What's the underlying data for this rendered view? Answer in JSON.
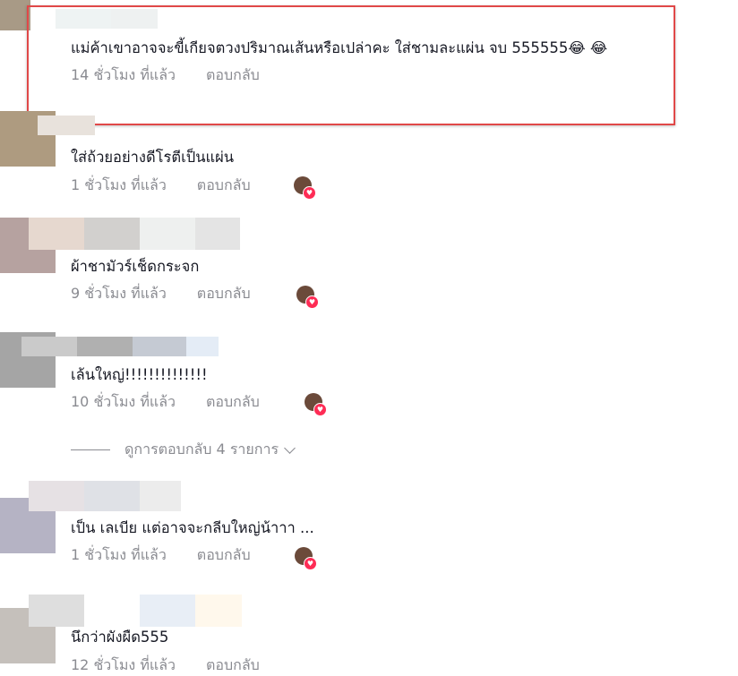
{
  "comments": [
    {
      "text": "แม่ค้าเขาอาจจะขี้เกียจตวงปริมาณเส้นหรือเปล่าคะ ใส่ชามละแผ่น จบ 555555😂 😂",
      "time": "14 ชั่วโมง ที่แล้ว",
      "reply": "ตอบกลับ",
      "avatar_color": "#a89a86",
      "liked_by_creator": false
    },
    {
      "text": "ใส่ถ้วยอย่างดีโรตีเป็นแผ่น",
      "time": "1 ชั่วโมง ที่แล้ว",
      "reply": "ตอบกลับ",
      "avatar_color": "#ae9b80",
      "liked_by_creator": true
    },
    {
      "text": "ผ้าชามัวร์เช็ดกระจก",
      "time": "9 ชั่วโมง ที่แล้ว",
      "reply": "ตอบกลับ",
      "avatar_color": "#b6a2a0",
      "liked_by_creator": true
    },
    {
      "text": "เล้นใหญ่!!!!!!!!!!!!!!",
      "time": "10 ชั่วโมง ที่แล้ว",
      "reply": "ตอบกลับ",
      "avatar_color": "#a5a5a5",
      "liked_by_creator": true
    },
    {
      "text": "เป็น เลเบีย แต่อาจจะกลีบใหญ่น้าาา ...",
      "time": "1 ชั่วโมง ที่แล้ว",
      "reply": "ตอบกลับ",
      "avatar_color": "#b5b3c4",
      "liked_by_creator": true
    },
    {
      "text": "นึกว่าผังผืด555",
      "time": "12 ชั่วโมง ที่แล้ว",
      "reply": "ตอบกลับ",
      "avatar_color": "#c5c0bb",
      "liked_by_creator": false
    }
  ],
  "view_replies": "ดูการตอบกลับ 4 รายการ",
  "colors": {
    "highlight": "#e04848",
    "heart": "#fe2c55",
    "meta": "#8a8b91"
  }
}
